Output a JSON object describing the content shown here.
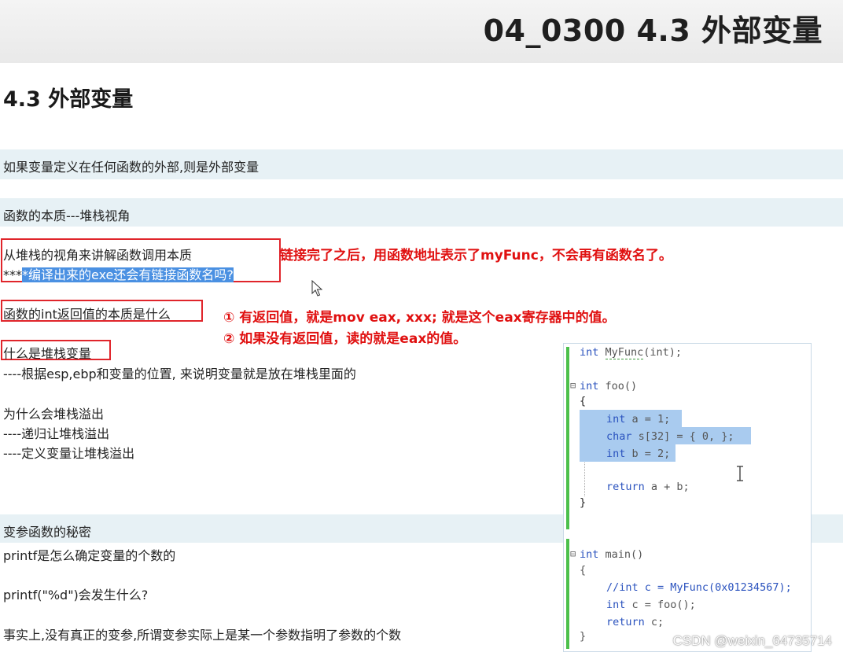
{
  "slide_title": "04_0300 4.3 外部变量",
  "section_heading": "4.3 外部变量",
  "lines": {
    "definition": "如果变量定义在任何函数的外部,则是外部变量",
    "essence_heading": "函数的本质---堆栈视角",
    "stack_view": "从堆栈的视角来讲解函数调用本质",
    "exe_question_prefix": "***",
    "exe_question_highlight": "*编译出来的exe还会有链接函数名吗?",
    "int_return": "函数的int返回值的本质是什么",
    "stack_var": "什么是堆栈变量",
    "stack_var_desc": "----根据esp,ebp和变量的位置, 来说明变量就是放在堆栈里面的",
    "overflow_q": "为什么会堆栈溢出",
    "overflow_recursion": "----递归让堆栈溢出",
    "overflow_define": "----定义变量让堆栈溢出",
    "varargs_heading": "变参函数的秘密",
    "printf_count": "printf是怎么确定变量的个数的",
    "printf_d": "printf(\"%d\")会发生什么?",
    "varargs_fact": "事实上,没有真正的变参,所谓变参实际上是某一个参数指明了参数的个数"
  },
  "annotations": {
    "link_note": "链接完了之后，用函数地址表示了myFunc，不会再有函数名了。",
    "ret_note_1": "① 有返回值，就是mov eax, xxx; 就是这个eax寄存器中的值。",
    "ret_note_2": "② 如果没有返回值，读的就是eax的值。"
  },
  "code": {
    "l1_type": "int ",
    "l1_name": "MyFunc",
    "l1_rest": "(int);",
    "l2_kw": "int",
    "l2_rest": " foo()",
    "l3": "{",
    "l4_kw": "int",
    "l4_rest": " a = 1;",
    "l5_kw": "char",
    "l5_rest": " s[32] = { 0, };",
    "l6_kw": "int",
    "l6_rest": " b = 2;",
    "l7_kw": "return",
    "l7_rest": " a + b;",
    "l8": "}",
    "l9_kw": "int",
    "l9_rest": " main()",
    "l10": "{",
    "l11": "//int c = MyFunc(0x01234567);",
    "l12_kw": "int",
    "l12_rest": " c = foo();",
    "l13_kw": "return",
    "l13_rest": " c;",
    "l14": "}"
  },
  "watermark": "CSDN @weixin_64735714",
  "colors": {
    "annotation_red": "#e01010",
    "band_bg": "#e7f1f5",
    "selection_blue": "#4a90e2",
    "code_keyword": "#2a52be"
  }
}
